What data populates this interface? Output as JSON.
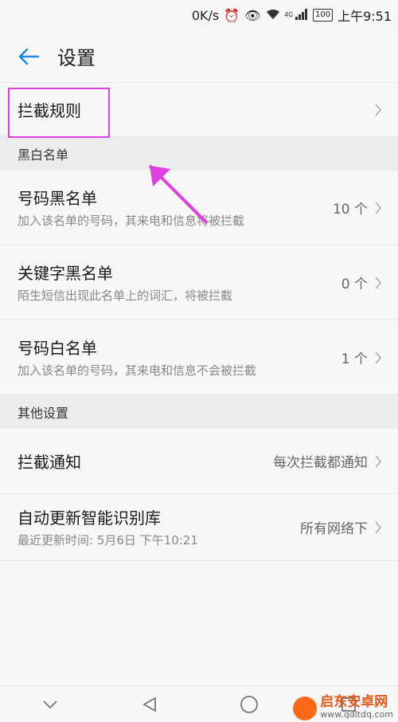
{
  "status_bar": {
    "network_speed": "0K/s",
    "alarm_icon": "alarm-icon",
    "eye_icon": "eye-icon",
    "wifi_icon": "wifi-icon",
    "signal_label": "4G",
    "battery": "100",
    "time": "上午9:51"
  },
  "header": {
    "title": "设置",
    "back_icon": "arrow-left-icon"
  },
  "rules": {
    "title": "拦截规则"
  },
  "blacklist_section": {
    "header": "黑白名单",
    "items": [
      {
        "title": "号码黑名单",
        "desc": "加入该名单的号码，其来电和信息将被拦截",
        "count": "10 个"
      },
      {
        "title": "关键字黑名单",
        "desc": "陌生短信出现此名单上的词汇，将被拦截",
        "count": "0 个"
      },
      {
        "title": "号码白名单",
        "desc": "加入该名单的号码，其来电和信息不会被拦截",
        "count": "1 个"
      }
    ]
  },
  "other_section": {
    "header": "其他设置",
    "notify": {
      "title": "拦截通知",
      "value": "每次拦截都通知"
    },
    "update": {
      "title": "自动更新智能识别库",
      "desc": "最近更新时间: 5月6日 下午10:21",
      "value": "所有网络下"
    }
  },
  "nav": {
    "back_icon": "nav-back-icon",
    "home_icon": "nav-home-icon",
    "recents_icon": "nav-recents-icon",
    "collapse_icon": "chevron-down-icon"
  },
  "watermark": {
    "main": "启东安卓网",
    "sub": "www.qdltdq.com"
  },
  "colors": {
    "accent": "#1e88e5",
    "annotation": "#e040e0"
  }
}
